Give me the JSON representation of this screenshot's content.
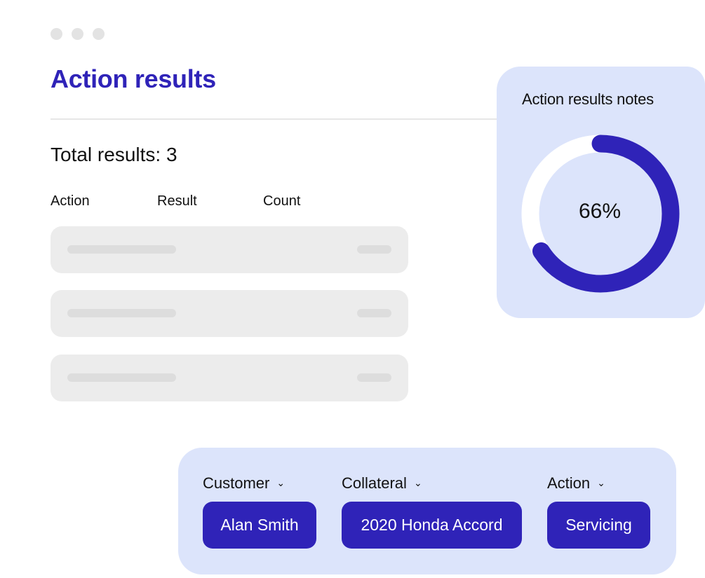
{
  "window": {
    "dots": [
      "dot",
      "dot",
      "dot"
    ]
  },
  "page": {
    "title": "Action results"
  },
  "summary": {
    "total_label": "Total results: 3"
  },
  "table": {
    "columns": [
      "Action",
      "Result",
      "Count"
    ],
    "rows": [
      "placeholder",
      "placeholder",
      "placeholder"
    ]
  },
  "notes": {
    "title": "Action results notes",
    "percent_label": "66%",
    "progress_fraction": 0.66,
    "colors": {
      "track": "#ffffff",
      "fill": "#2f23b8",
      "card": "#dce4fb"
    }
  },
  "filters": [
    {
      "label": "Customer",
      "value": "Alan Smith",
      "icon": "chevron-down-icon"
    },
    {
      "label": "Collateral",
      "value": "2020 Honda Accord",
      "icon": "chevron-down-icon"
    },
    {
      "label": "Action",
      "value": "Servicing",
      "icon": "chevron-down-icon"
    }
  ],
  "colors": {
    "accent": "#2f23b8",
    "panel": "#dce4fb",
    "placeholder": "#ececec"
  }
}
